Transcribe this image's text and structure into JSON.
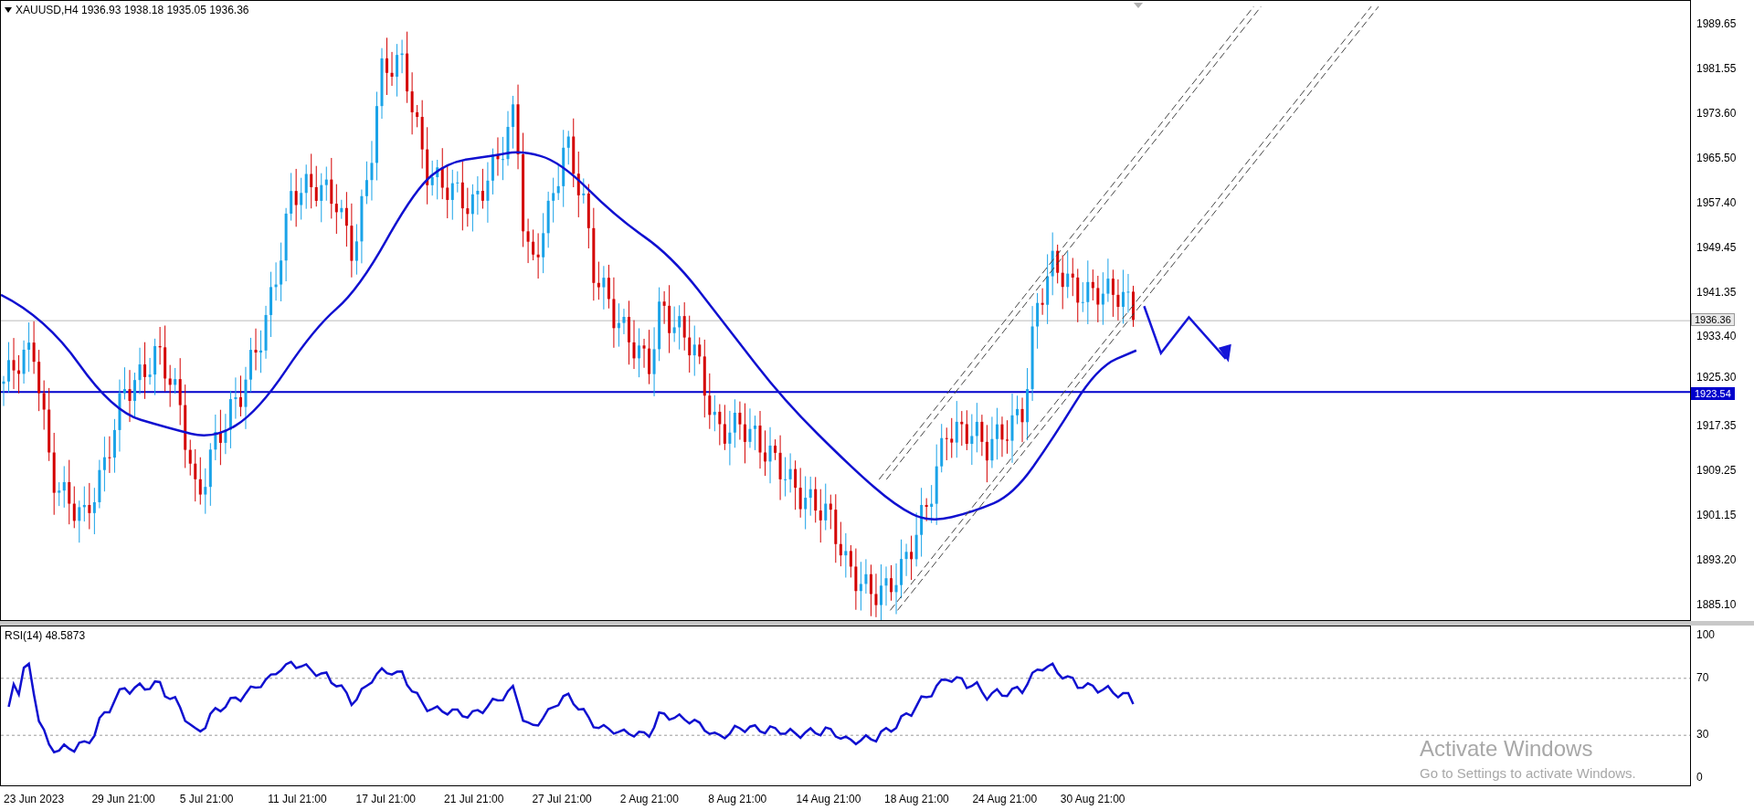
{
  "chart": {
    "symbol_header": "XAUUSD,H4 1936.93 1938.18 1935.05 1936.36",
    "price_axis": [
      "1989.65",
      "1981.55",
      "1973.60",
      "1965.50",
      "1957.40",
      "1949.45",
      "1941.35",
      "1933.40",
      "1925.30",
      "1917.35",
      "1909.25",
      "1901.15",
      "1893.20",
      "1885.10"
    ],
    "current_price": "1936.36",
    "line_price": "1923.54"
  },
  "indicator": {
    "label": "RSI(14) 48.5873",
    "axis": [
      "100",
      "70",
      "30",
      "0"
    ]
  },
  "time_axis": [
    "23 Jun 2023",
    "29 Jun 21:00",
    "5 Jul 21:00",
    "11 Jul 21:00",
    "17 Jul 21:00",
    "21 Jul 21:00",
    "27 Jul 21:00",
    "2 Aug 21:00",
    "8 Aug 21:00",
    "14 Aug 21:00",
    "18 Aug 21:00",
    "24 Aug 21:00",
    "30 Aug 21:00"
  ],
  "activation_notice": {
    "title": "Activate Windows",
    "subtitle": "Go to Settings to activate Windows."
  }
}
